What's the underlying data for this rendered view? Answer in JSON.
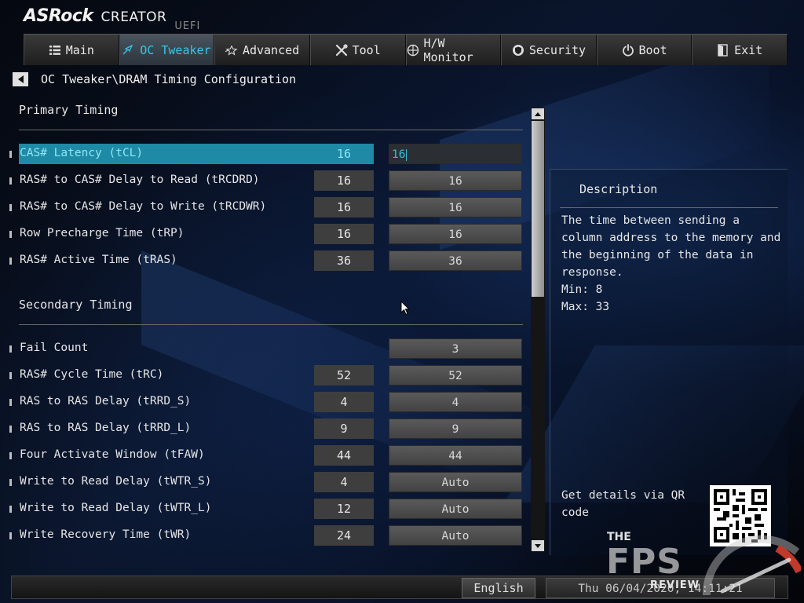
{
  "header": {
    "brand": "ASRock",
    "product": "CREATOR",
    "suffix": "UEFI"
  },
  "tabs": [
    {
      "label": "Main",
      "icon": "list-icon",
      "active": false
    },
    {
      "label": "OC Tweaker",
      "icon": "rocket-icon",
      "active": true
    },
    {
      "label": "Advanced",
      "icon": "star-icon",
      "active": false
    },
    {
      "label": "Tool",
      "icon": "tools-icon",
      "active": false
    },
    {
      "label": "H/W Monitor",
      "icon": "monitor-icon",
      "active": false
    },
    {
      "label": "Security",
      "icon": "shield-icon",
      "active": false
    },
    {
      "label": "Boot",
      "icon": "power-icon",
      "active": false
    },
    {
      "label": "Exit",
      "icon": "exit-icon",
      "active": false
    }
  ],
  "breadcrumb": "OC Tweaker\\DRAM Timing Configuration",
  "sections": {
    "primary": "Primary Timing",
    "secondary": "Secondary Timing"
  },
  "primary_rows": [
    {
      "label": "CAS# Latency (tCL)",
      "current": "16",
      "setting": "16"
    },
    {
      "label": "RAS# to CAS# Delay to Read  (tRCDRD)",
      "current": "16",
      "setting": "16"
    },
    {
      "label": "RAS# to CAS# Delay to Write (tRCDWR)",
      "current": "16",
      "setting": "16"
    },
    {
      "label": "Row Precharge Time (tRP)",
      "current": "16",
      "setting": "16"
    },
    {
      "label": "RAS# Active Time (tRAS)",
      "current": "36",
      "setting": "36"
    }
  ],
  "secondary_rows": [
    {
      "label": "Fail Count",
      "current": "",
      "setting": "3"
    },
    {
      "label": "RAS# Cycle Time (tRC)",
      "current": "52",
      "setting": "52"
    },
    {
      "label": "RAS to RAS Delay (tRRD_S)",
      "current": "4",
      "setting": "4"
    },
    {
      "label": "RAS to RAS Delay (tRRD_L)",
      "current": "9",
      "setting": "9"
    },
    {
      "label": "Four Activate Window (tFAW)",
      "current": "44",
      "setting": "44"
    },
    {
      "label": "Write to Read Delay (tWTR_S)",
      "current": "4",
      "setting": "Auto"
    },
    {
      "label": "Write to Read Delay (tWTR_L)",
      "current": "12",
      "setting": "Auto"
    },
    {
      "label": "Write Recovery Time (tWR)",
      "current": "24",
      "setting": "Auto"
    }
  ],
  "description": {
    "title": "Description",
    "text": "The time between sending a column address to the memory and the beginning of the data in response.",
    "min": "Min: 8",
    "max": "Max: 33",
    "qr_text": "Get details via QR code"
  },
  "footer": {
    "language": "English",
    "datetime": "Thu 06/04/2020, 14:11:21"
  },
  "watermark": {
    "the": "THE",
    "fps": "FPS",
    "review": "REVIEW"
  },
  "colors": {
    "accent": "#37c7e6",
    "selection": "#1e8aa6"
  }
}
